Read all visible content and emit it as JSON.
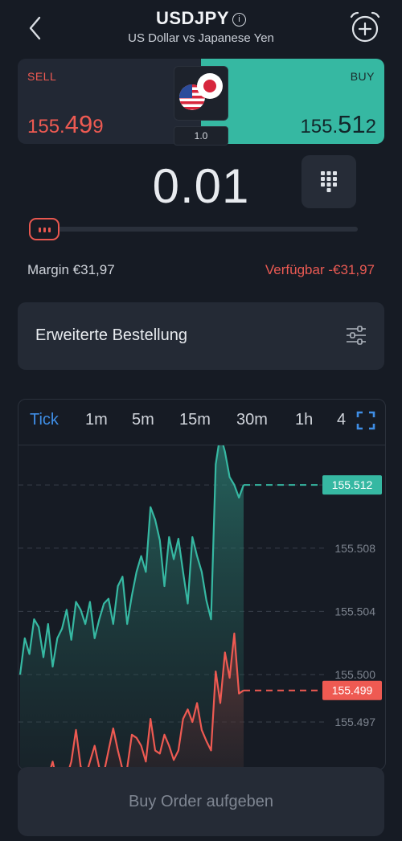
{
  "header": {
    "symbol": "USDJPY",
    "subtitle": "US Dollar vs Japanese Yen",
    "icons": [
      "back-chevron-icon",
      "info-icon",
      "alarm-clock-add-icon"
    ]
  },
  "quote": {
    "sell_label": "SELL",
    "sell_price_prefix": "155.",
    "sell_price_big": "49",
    "sell_price_suffix": "9",
    "buy_label": "BUY",
    "buy_price_prefix": "155.",
    "buy_price_big": "51",
    "buy_price_suffix": "2",
    "spread": "1.0",
    "flags": [
      "us-flag-icon",
      "japan-flag-icon"
    ],
    "colors": {
      "sell": "#ee5a52",
      "buy": "#36b8a2"
    }
  },
  "volume": {
    "value": "0.01",
    "keypad_icon": "keypad-icon",
    "slider_level": 0
  },
  "margin": {
    "margin_text": "Margin €31,97",
    "available_text": "Verfügbar -€31,97"
  },
  "advanced_order": {
    "label": "Erweiterte Bestellung",
    "icon": "sliders-icon"
  },
  "chart_tabs": {
    "items": [
      "Tick",
      "1m",
      "5m",
      "15m",
      "30m",
      "1h",
      "4"
    ],
    "active": "Tick",
    "fullscreen_icon": "fullscreen-icon"
  },
  "chart_data": {
    "type": "area",
    "y_ticks": [
      "155.512",
      "155.508",
      "155.504",
      "155.500",
      "155.497"
    ],
    "ylim": [
      155.494,
      155.5145
    ],
    "grid": true,
    "series": [
      {
        "role": "buy",
        "color": "#36b8a2",
        "last_label": "155.512",
        "values": [
          155.5,
          155.5023,
          155.5013,
          155.5035,
          155.503,
          155.5011,
          155.5032,
          155.5005,
          155.5023,
          155.5029,
          155.5041,
          155.5022,
          155.5046,
          155.5041,
          155.5032,
          155.5046,
          155.5023,
          155.5035,
          155.5045,
          155.5048,
          155.5032,
          155.5056,
          155.5062,
          155.5032,
          155.505,
          155.5065,
          155.5075,
          155.5065,
          155.5106,
          155.5098,
          155.5085,
          155.5056,
          155.5087,
          155.5073,
          155.5086,
          155.5065,
          155.5045,
          155.5087,
          155.5075,
          155.5065,
          155.5047,
          155.5035,
          155.5133,
          155.5152,
          155.5141,
          155.5125,
          155.512,
          155.5112,
          155.512
        ]
      },
      {
        "role": "sell",
        "color": "#ee5a52",
        "last_label": "155.499",
        "values": [
          155.4935,
          155.4935,
          155.494,
          155.4935,
          155.4932,
          155.4935,
          155.4935,
          155.4945,
          155.4932,
          155.494,
          155.4935,
          155.4945,
          155.4965,
          155.4942,
          155.4935,
          155.4945,
          155.4955,
          155.4941,
          155.4938,
          155.4952,
          155.4966,
          155.4952,
          155.494,
          155.4941,
          155.4962,
          155.496,
          155.4955,
          155.4945,
          155.4972,
          155.4952,
          155.495,
          155.4962,
          155.4955,
          155.4946,
          155.4952,
          155.4972,
          155.4978,
          155.497,
          155.4982,
          155.4965,
          155.4958,
          155.4952,
          155.5002,
          155.4982,
          155.5014,
          155.4998,
          155.5026,
          155.4988,
          155.499
        ]
      }
    ]
  },
  "footer": {
    "order_button": "Buy Order aufgeben"
  }
}
